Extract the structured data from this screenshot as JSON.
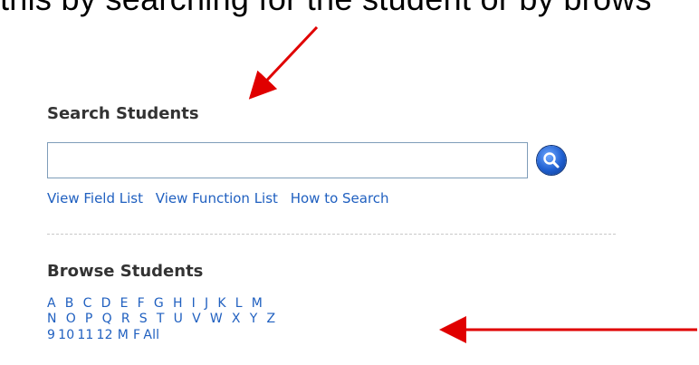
{
  "caption": "this by searching for the student or by brows",
  "search": {
    "title": "Search Students",
    "input_value": "",
    "button_icon": "magnifier-icon",
    "links": [
      "View Field List",
      "View Function List",
      "How to Search"
    ]
  },
  "browse": {
    "title": "Browse Students",
    "row1": [
      "A",
      "B",
      "C",
      "D",
      "E",
      "F",
      "G",
      "H",
      "I",
      "J",
      "K",
      "L",
      "M"
    ],
    "row2": [
      "N",
      "O",
      "P",
      "Q",
      "R",
      "S",
      "T",
      "U",
      "V",
      "W",
      "X",
      "Y",
      "Z"
    ],
    "row3": [
      "9",
      "10",
      "11",
      "12",
      "M",
      "F",
      "All"
    ]
  },
  "colors": {
    "link": "#2060c0",
    "arrow": "#e00000",
    "title": "#333333"
  }
}
